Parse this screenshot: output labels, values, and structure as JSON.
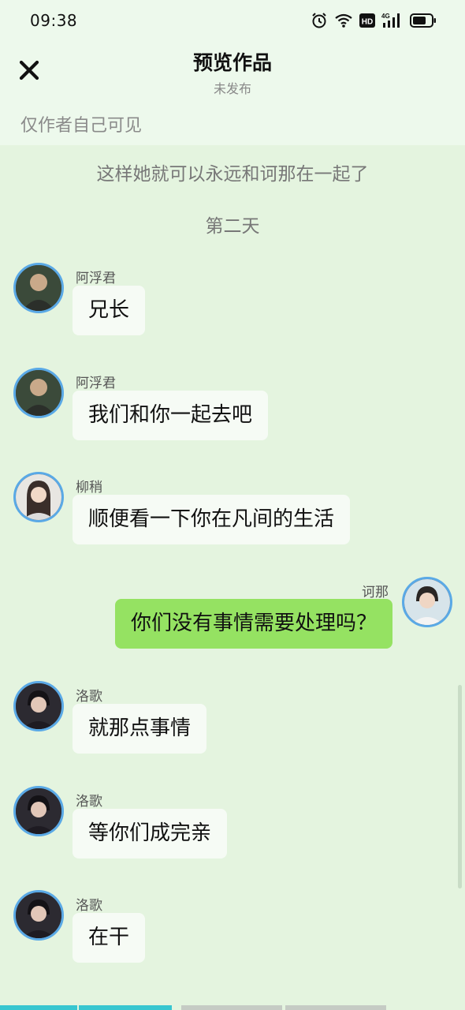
{
  "status_bar": {
    "time": "09:38",
    "icons": [
      "alarm-icon",
      "wifi-icon",
      "hd-icon",
      "signal-4g-icon",
      "battery-icon"
    ],
    "network_badge": "4G",
    "hd_badge": "HD"
  },
  "header": {
    "title": "预览作品",
    "subtitle": "未发布",
    "visibility_note": "仅作者自己可见",
    "close_icon": "close-icon"
  },
  "chat": {
    "system_lines": [
      "这样她就可以永远和诃那在一起了",
      "第二天"
    ],
    "messages": [
      {
        "sender": "阿浮君",
        "text": "兄长",
        "side": "left"
      },
      {
        "sender": "阿浮君",
        "text": "我们和你一起去吧",
        "side": "left"
      },
      {
        "sender": "柳稍",
        "text": "顺便看一下你在凡间的生活",
        "side": "left"
      },
      {
        "sender": "诃那",
        "text": "你们没有事情需要处理吗？",
        "side": "right"
      },
      {
        "sender": "洛歌",
        "text": "就那点事情",
        "side": "left"
      },
      {
        "sender": "洛歌",
        "text": "等你们成完亲",
        "side": "left"
      },
      {
        "sender": "洛歌",
        "text": "在干",
        "side": "left"
      }
    ]
  },
  "colors": {
    "background": "#e4f4df",
    "header_bg": "#edf9ec",
    "bubble_other": "#f6fbf5",
    "bubble_self": "#95e262",
    "avatar_ring": "#5aa9e6"
  }
}
